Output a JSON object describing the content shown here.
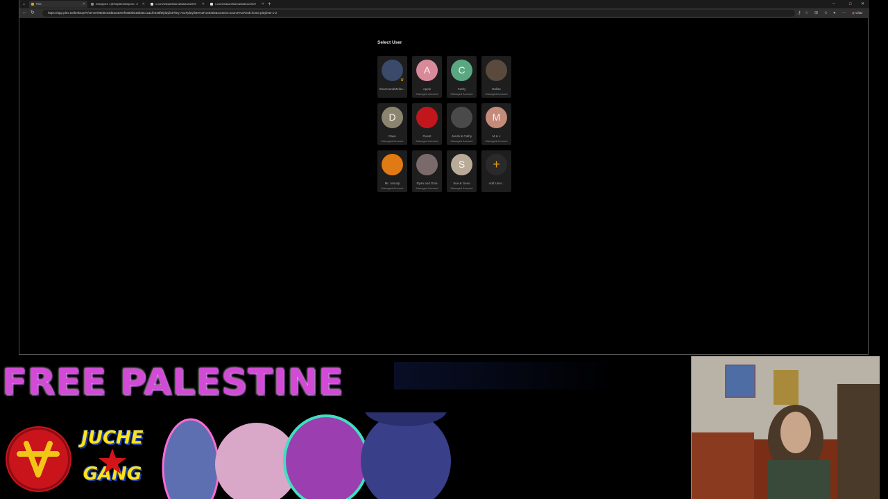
{
  "browser": {
    "tabs": [
      {
        "label": "Plex",
        "active": true
      },
      {
        "label": "Instagram • @thepalestinepost • X"
      },
      {
        "label": "x.com/masantiharnal/status/2009"
      },
      {
        "label": "x.com/masantiharnal/status/2009"
      }
    ],
    "url": "https://app.plex.tv/desktop/#!/server/98d0c54d62a40eef4580b518b35cca11fe538f8/playlist?key=%2Fplaylists%2F146304&context=source%3Ahub.home.playlists-1-2",
    "chat_label": "Chat"
  },
  "plex": {
    "title": "Select User",
    "users": [
      {
        "name": "ShameandMelan...",
        "sub": "",
        "initial": "",
        "color": "#3a4a6a",
        "icon": "photo-avatar",
        "admin": true
      },
      {
        "name": "Apple",
        "sub": "Managed Account",
        "initial": "A",
        "color": "#d98a9a"
      },
      {
        "name": "Cathy",
        "sub": "Managed Account",
        "initial": "C",
        "color": "#5aa882"
      },
      {
        "name": "Dallas",
        "sub": "Managed Account",
        "initial": "",
        "color": "#5a4a3e",
        "icon": "photo-avatar"
      },
      {
        "name": "Dave",
        "sub": "Managed Account",
        "initial": "D",
        "color": "#8b846e"
      },
      {
        "name": "Guest",
        "sub": "Managed Account",
        "initial": "",
        "color": "#c0161c",
        "icon": "emblem-avatar"
      },
      {
        "name": "Jacob & Cathy",
        "sub": "Managed Account",
        "initial": "",
        "color": "#4a4a4a",
        "icon": "photo-avatar"
      },
      {
        "name": "M & L",
        "sub": "Managed Account",
        "initial": "M",
        "color": "#c48a7a"
      },
      {
        "name": "Mr. Jesusp",
        "sub": "Managed Account",
        "initial": "",
        "color": "#e07a14",
        "icon": "emblem-avatar"
      },
      {
        "name": "Ryan and Gina",
        "sub": "Managed Account",
        "initial": "",
        "color": "#7a6a6a",
        "icon": "photo-avatar"
      },
      {
        "name": "Sue & Gene",
        "sub": "Managed Account",
        "initial": "S",
        "color": "#b9ab98"
      },
      {
        "name": "Add User...",
        "sub": "",
        "initial": "+",
        "color": "#2a2a2a",
        "icon": "plus-icon",
        "add": true
      }
    ]
  },
  "overlay": {
    "banner": "FREE PALESTINE",
    "badge_line1": "JUCHE",
    "badge_line2": "GANG"
  },
  "colors": {
    "plex_accent": "#e5a00d",
    "banner_magenta": "#d24ad6",
    "badge_yellow": "#ffe21a",
    "emblem_red": "#c9141c"
  }
}
